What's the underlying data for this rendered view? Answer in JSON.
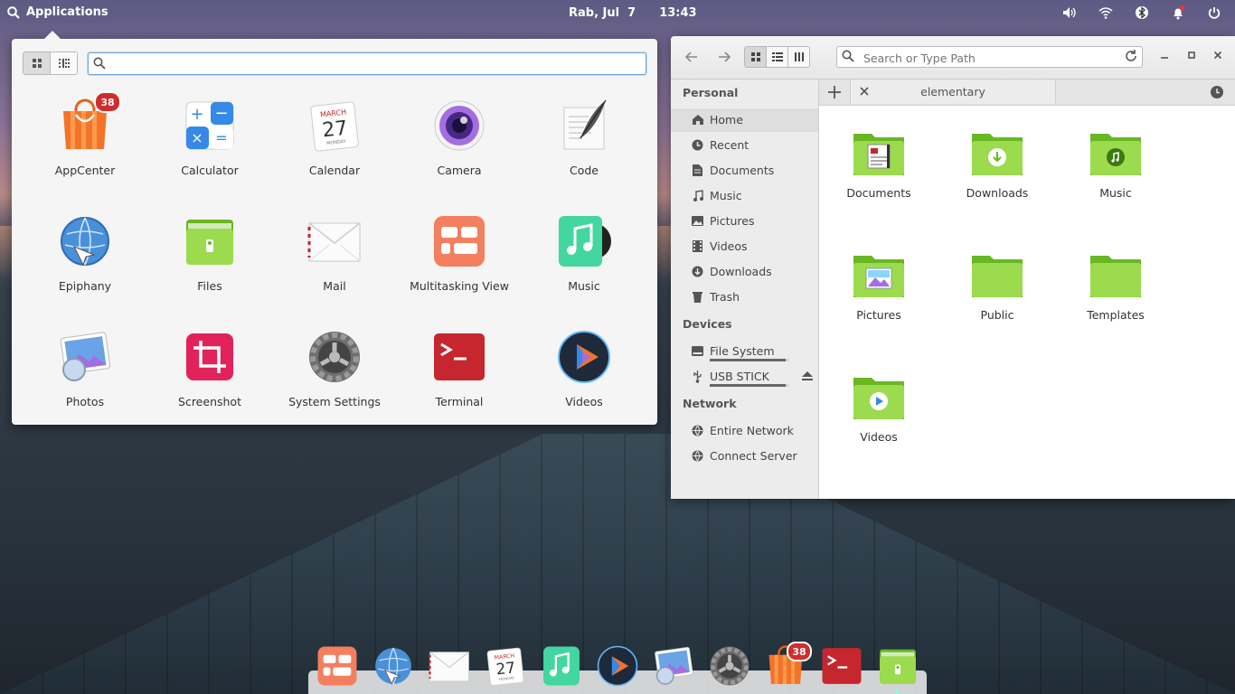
{
  "top_panel": {
    "apps_label": "Applications",
    "date": "Rab, Jul  7",
    "time": "13:43",
    "indicators": [
      "volume-icon",
      "wifi-icon",
      "bluetooth-icon",
      "notifications-icon",
      "power-icon"
    ]
  },
  "app_menu": {
    "search_placeholder": "",
    "apps": [
      {
        "name": "AppCenter",
        "icon": "appcenter-icon",
        "badge": "38"
      },
      {
        "name": "Calculator",
        "icon": "calculator-icon"
      },
      {
        "name": "Calendar",
        "icon": "calendar-icon",
        "month": "MARCH",
        "day": "27",
        "weekday": "MONDAY"
      },
      {
        "name": "Camera",
        "icon": "camera-icon"
      },
      {
        "name": "Code",
        "icon": "code-icon"
      },
      {
        "name": "Epiphany",
        "icon": "epiphany-icon"
      },
      {
        "name": "Files",
        "icon": "files-icon"
      },
      {
        "name": "Mail",
        "icon": "mail-icon"
      },
      {
        "name": "Multitasking View",
        "icon": "multitasking-icon"
      },
      {
        "name": "Music",
        "icon": "music-icon"
      },
      {
        "name": "Photos",
        "icon": "photos-icon"
      },
      {
        "name": "Screenshot",
        "icon": "screenshot-icon"
      },
      {
        "name": "System Settings",
        "icon": "settings-icon"
      },
      {
        "name": "Terminal",
        "icon": "terminal-icon"
      },
      {
        "name": "Videos",
        "icon": "videos-icon"
      }
    ]
  },
  "files": {
    "path_placeholder": "Search or Type Path",
    "tab_label": "elementary",
    "sidebar": {
      "personal_header": "Personal",
      "personal": [
        {
          "label": "Home",
          "icon": "home-icon"
        },
        {
          "label": "Recent",
          "icon": "recent-icon"
        },
        {
          "label": "Documents",
          "icon": "document-icon"
        },
        {
          "label": "Music",
          "icon": "music-note-icon"
        },
        {
          "label": "Pictures",
          "icon": "picture-icon"
        },
        {
          "label": "Videos",
          "icon": "video-icon"
        },
        {
          "label": "Downloads",
          "icon": "download-icon"
        },
        {
          "label": "Trash",
          "icon": "trash-icon"
        }
      ],
      "devices_header": "Devices",
      "devices": [
        {
          "label": "File System",
          "icon": "drive-icon",
          "usage": 0.95
        },
        {
          "label": "USB STICK",
          "icon": "usb-icon",
          "usage": 0.95
        }
      ],
      "network_header": "Network",
      "network": [
        {
          "label": "Entire Network",
          "icon": "network-icon"
        },
        {
          "label": "Connect Server",
          "icon": "server-icon"
        }
      ]
    },
    "folders": [
      "Documents",
      "Downloads",
      "Music",
      "Pictures",
      "Public",
      "Templates",
      "Videos"
    ]
  },
  "dock": {
    "items": [
      "multitasking-icon",
      "epiphany-icon",
      "mail-icon",
      "calendar-icon",
      "music-icon",
      "videos-icon",
      "photos-icon",
      "settings-icon",
      "appcenter-icon",
      "terminal-icon",
      "files-icon"
    ],
    "appcenter_badge": "38",
    "calendar_month": "MARCH",
    "calendar_day": "27",
    "calendar_weekday": "MONDAY"
  },
  "colors": {
    "accent": "#6ea6d8",
    "folder_green": "#8cc63e",
    "badge_red": "#d12d2d"
  }
}
